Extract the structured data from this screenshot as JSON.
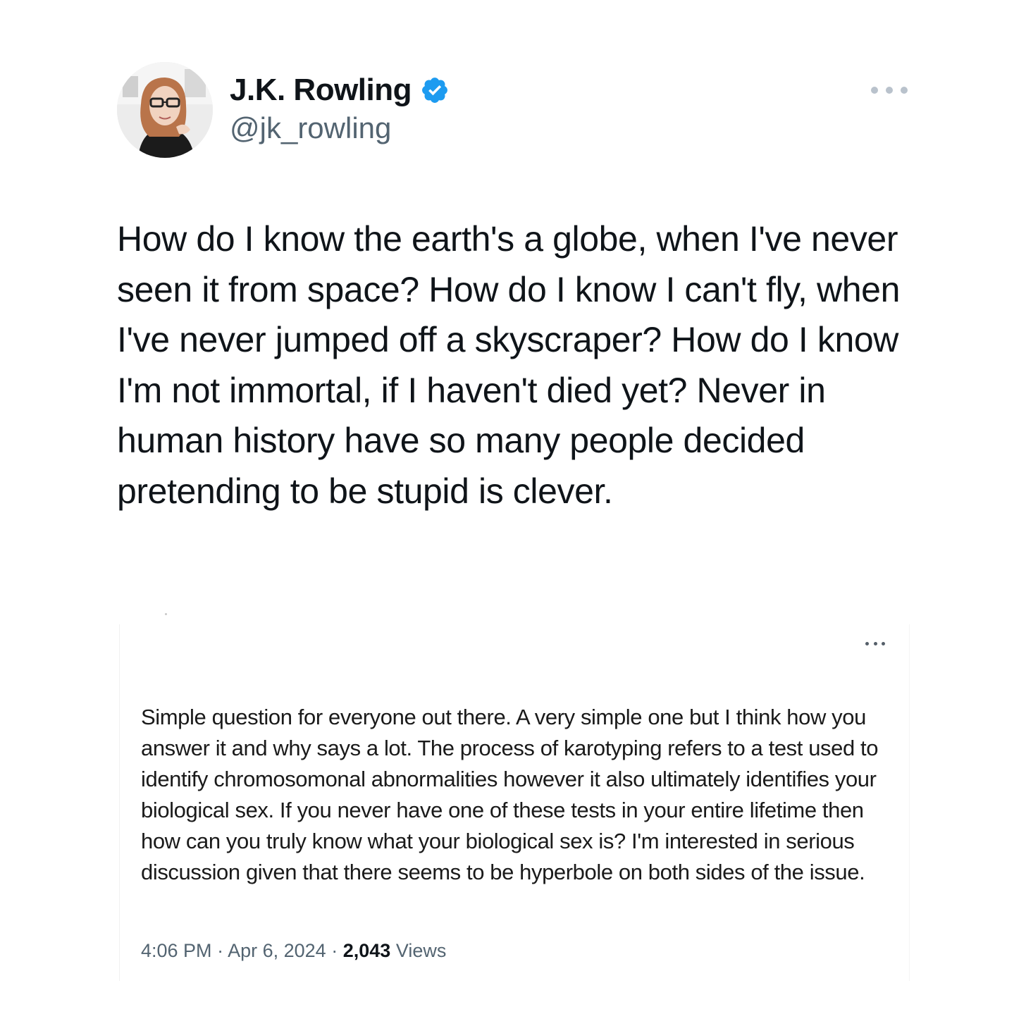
{
  "author": {
    "display_name": "J.K. Rowling",
    "handle": "@jk_rowling",
    "verified": true,
    "verified_color": "#1d9bf0",
    "avatar_icon": "profile-photo"
  },
  "tweet": {
    "text": "How do I know the earth's a globe, when I've never seen it from space? How do I know I can't fly, when I've never jumped off a skyscraper? How do I know I'm not immortal, if I haven't died yet? Never in human history have so many people decided pretending to be stupid is clever."
  },
  "quoted_tweet": {
    "text": "Simple question for everyone out there. A very simple one but I think how you answer it and why says a lot. The process of karotyping refers to a test used to identify chromosomonal abnormalities however it also ultimately identifies your biological sex. If you never have one of these tests in your entire lifetime then how can you truly know what your biological sex is? I'm interested in serious discussion given that there seems to be hyperbole on both sides of the issue.",
    "time": "4:06 PM",
    "separator": "·",
    "date": "Apr 6, 2024",
    "views_count": "2,043",
    "views_label": "Views"
  },
  "colors": {
    "text_primary": "#0f1419",
    "text_secondary": "#536471",
    "more_icon": "#b9c2cc"
  }
}
